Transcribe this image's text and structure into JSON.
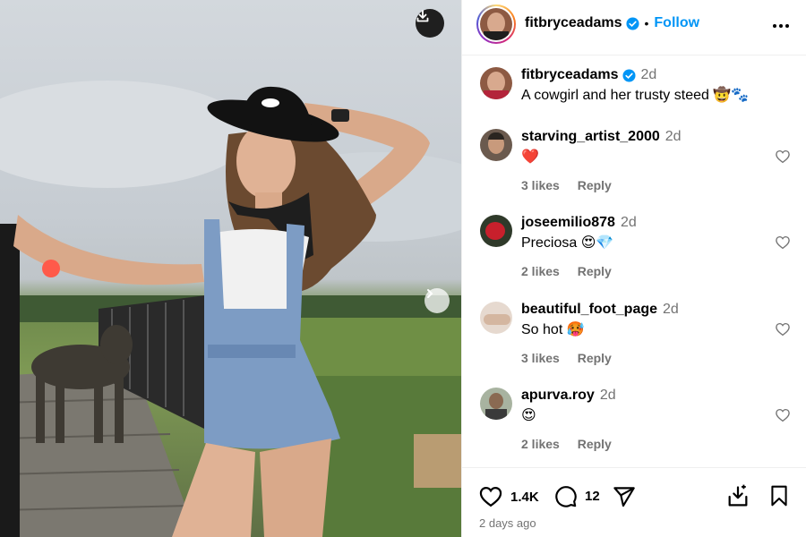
{
  "post": {
    "author": "fitbryceadams",
    "follow_label": "Follow",
    "dot": "•",
    "caption": "A cowgirl and her trusty steed 🤠🐾",
    "caption_age": "2d",
    "likes": "1.4K",
    "comments_count": "12",
    "timestamp": "2 days ago"
  },
  "comments": [
    {
      "user": "starving_artist_2000",
      "age": "2d",
      "text": "❤️",
      "likes": "3 likes",
      "reply": "Reply"
    },
    {
      "user": "joseemilio878",
      "age": "2d",
      "text": "Preciosa 😍💎",
      "likes": "2 likes",
      "reply": "Reply"
    },
    {
      "user": "beautiful_foot_page",
      "age": "2d",
      "text": "So hot 🥵",
      "likes": "3 likes",
      "reply": "Reply"
    },
    {
      "user": "apurva.roy",
      "age": "2d",
      "text": "😍",
      "likes": "2 likes",
      "reply": "Reply"
    }
  ],
  "colors": {
    "accent": "#0095f6",
    "verified": "#0095f6",
    "muted": "#737373",
    "border": "#efefef"
  },
  "icons": {
    "download": "download-icon",
    "next": "chevron-right-icon",
    "more": "more-horizontal-icon",
    "verified": "verified-badge-icon",
    "heart": "heart-icon",
    "comment": "comment-icon",
    "share": "paper-plane-icon",
    "save": "bookmark-icon",
    "save_download": "save-download-icon"
  }
}
